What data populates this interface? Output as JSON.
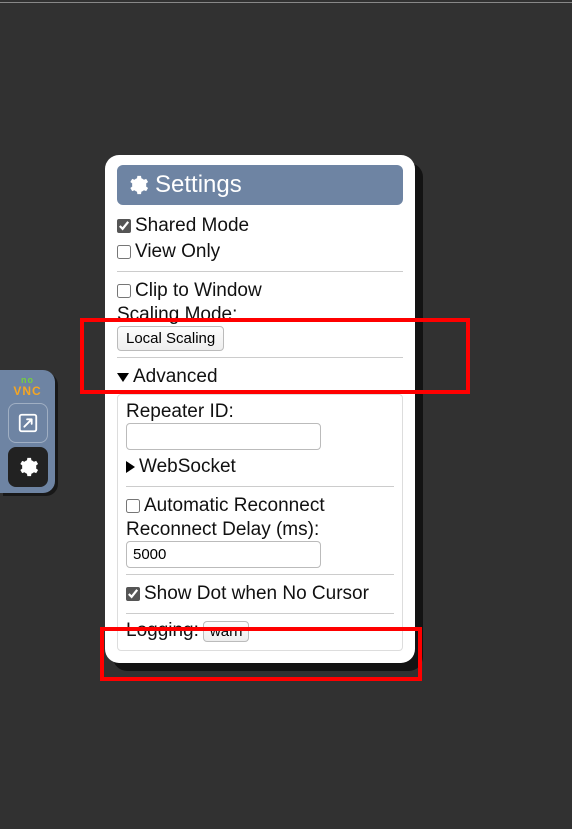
{
  "sidebar": {
    "logo_top": "no",
    "logo_bottom": "VNC"
  },
  "panel": {
    "title": "Settings",
    "shared_mode": {
      "label": "Shared Mode",
      "checked": true
    },
    "view_only": {
      "label": "View Only",
      "checked": false
    },
    "clip_to_window": {
      "label": "Clip to Window",
      "checked": false
    },
    "scaling_mode": {
      "label": "Scaling Mode:",
      "value": "Local Scaling"
    },
    "advanced": {
      "label": "Advanced",
      "repeater_id": {
        "label": "Repeater ID:",
        "value": ""
      },
      "websocket": {
        "label": "WebSocket"
      },
      "auto_reconnect": {
        "label": "Automatic Reconnect",
        "checked": false
      },
      "reconnect_delay": {
        "label": "Reconnect Delay (ms):",
        "value": "5000"
      },
      "show_dot": {
        "label": "Show Dot when No Cursor",
        "checked": true
      },
      "logging": {
        "label": "Logging:",
        "value": "warn"
      }
    }
  }
}
